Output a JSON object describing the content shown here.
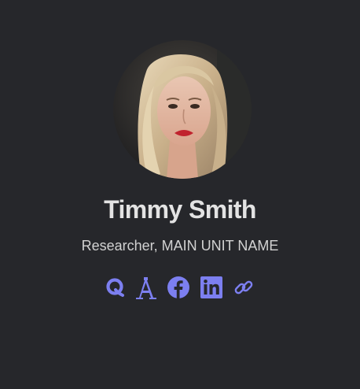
{
  "profile": {
    "name": "Timmy Smith",
    "subtitle": "Researcher, MAIN UNIT NAME"
  },
  "social_links": [
    {
      "icon": "quora-icon"
    },
    {
      "icon": "academia-icon"
    },
    {
      "icon": "facebook-icon"
    },
    {
      "icon": "linkedin-icon"
    },
    {
      "icon": "link-icon"
    }
  ],
  "colors": {
    "background": "#26272b",
    "accent": "#7c7ff0",
    "name_text": "#e3e3e3",
    "subtitle_text": "#d2d2d2"
  }
}
